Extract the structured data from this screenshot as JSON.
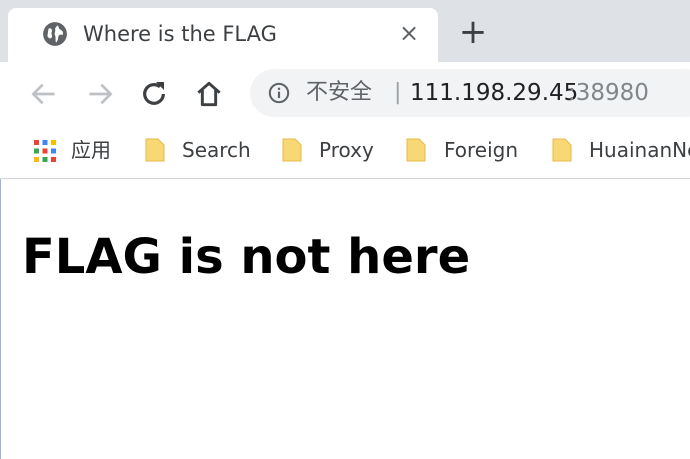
{
  "tab": {
    "title": "Where is the FLAG",
    "close_label": "×",
    "new_tab_label": "+"
  },
  "toolbar": {
    "back_icon": "arrow-left-icon",
    "forward_icon": "arrow-right-icon",
    "reload_icon": "reload-icon",
    "home_icon": "home-icon"
  },
  "omnibox": {
    "security_text": "不安全",
    "separator": "|",
    "host": "111.198.29.45",
    "port": ":38980"
  },
  "bookmarks": {
    "apps_label": "应用",
    "items": [
      {
        "label": "Search"
      },
      {
        "label": "Proxy"
      },
      {
        "label": "Foreign"
      },
      {
        "label": "HuainanNe"
      }
    ]
  },
  "page": {
    "heading": "FLAG is not here"
  },
  "colors": {
    "tabstrip_bg": "#dee1e6",
    "omnibox_bg": "#f1f3f4",
    "folder_yellow": "#f8d775",
    "text_dark": "#202124"
  }
}
